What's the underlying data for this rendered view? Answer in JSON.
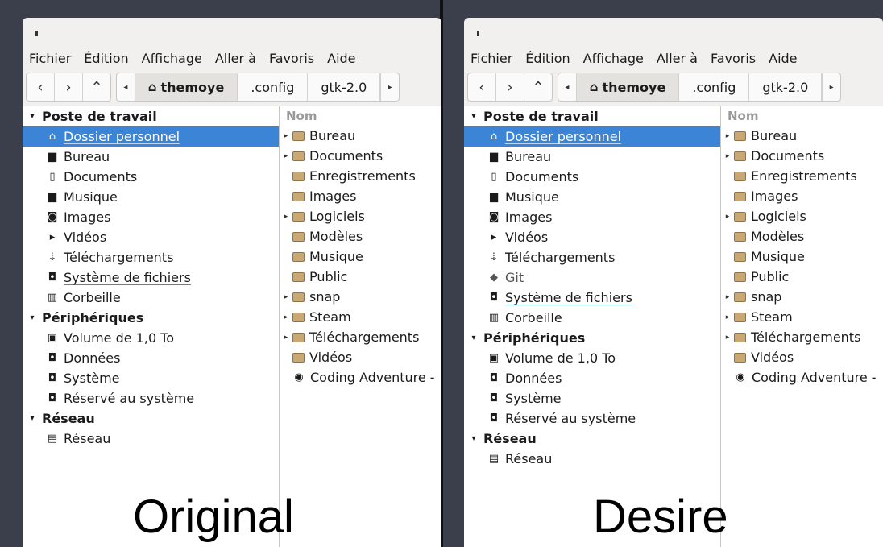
{
  "left": {
    "menu": [
      "Fichier",
      "Édition",
      "Affichage",
      "Aller à",
      "Favoris",
      "Aide"
    ],
    "nav": {
      "back": "‹",
      "forward": "›",
      "up": "⌃"
    },
    "path": {
      "left_arrow": "◂",
      "right_arrow": "▸",
      "crumbs": [
        "themoye",
        ".config",
        "gtk-2.0"
      ]
    },
    "sidebar": {
      "sections": [
        {
          "title": "Poste de travail",
          "items": [
            {
              "label": "Dossier personnel",
              "icon": "⌂",
              "selected": true
            },
            {
              "label": "Bureau",
              "icon": "▆"
            },
            {
              "label": "Documents",
              "icon": "▯"
            },
            {
              "label": "Musique",
              "icon": "▆"
            },
            {
              "label": "Images",
              "icon": "◙"
            },
            {
              "label": "Vidéos",
              "icon": "▸"
            },
            {
              "label": "Téléchargements",
              "icon": "⇣"
            },
            {
              "label": "Système de fichiers",
              "icon": "◘"
            },
            {
              "label": "Corbeille",
              "icon": "▥"
            }
          ]
        },
        {
          "title": "Périphériques",
          "items": [
            {
              "label": "Volume de 1,0 To",
              "icon": "▣"
            },
            {
              "label": "Données",
              "icon": "◘"
            },
            {
              "label": "Système",
              "icon": "◘"
            },
            {
              "label": "Réservé au système",
              "icon": "◘"
            }
          ]
        },
        {
          "title": "Réseau",
          "items": [
            {
              "label": "Réseau",
              "icon": "▤"
            }
          ]
        }
      ]
    },
    "files": {
      "column": "Nom",
      "rows": [
        "Bureau",
        "Documents",
        "Enregistrements",
        "Images",
        "Logiciels",
        "Modèles",
        "Musique",
        "Public",
        "snap",
        "Steam",
        "Téléchargements",
        "Vidéos",
        "Coding Adventure -"
      ]
    },
    "caption": "Original"
  },
  "right": {
    "menu": [
      "Fichier",
      "Édition",
      "Affichage",
      "Aller à",
      "Favoris",
      "Aide"
    ],
    "nav": {
      "back": "‹",
      "forward": "›",
      "up": "⌃"
    },
    "path": {
      "left_arrow": "◂",
      "right_arrow": "▸",
      "crumbs": [
        "themoye",
        ".config",
        "gtk-2.0"
      ]
    },
    "sidebar": {
      "sections": [
        {
          "title": "Poste de travail",
          "items": [
            {
              "label": "Dossier personnel",
              "icon": "⌂",
              "selected": true
            },
            {
              "label": "Bureau",
              "icon": "▆"
            },
            {
              "label": "Documents",
              "icon": "▯"
            },
            {
              "label": "Musique",
              "icon": "▆"
            },
            {
              "label": "Images",
              "icon": "◙"
            },
            {
              "label": "Vidéos",
              "icon": "▸"
            },
            {
              "label": "Téléchargements",
              "icon": "⇣"
            },
            {
              "label": "Git",
              "icon": "◆"
            },
            {
              "label": "Système de fichiers",
              "icon": "◘"
            },
            {
              "label": "Corbeille",
              "icon": "▥"
            }
          ]
        },
        {
          "title": "Périphériques",
          "items": [
            {
              "label": "Volume de 1,0 To",
              "icon": "▣"
            },
            {
              "label": "Données",
              "icon": "◘"
            },
            {
              "label": "Système",
              "icon": "◘"
            },
            {
              "label": "Réservé au système",
              "icon": "◘"
            }
          ]
        },
        {
          "title": "Réseau",
          "items": [
            {
              "label": "Réseau",
              "icon": "▤"
            }
          ]
        }
      ]
    },
    "files": {
      "column": "Nom",
      "rows": [
        "Bureau",
        "Documents",
        "Enregistrements",
        "Images",
        "Logiciels",
        "Modèles",
        "Musique",
        "Public",
        "snap",
        "Steam",
        "Téléchargements",
        "Vidéos",
        "Coding Adventure -"
      ]
    },
    "caption": "Desire"
  }
}
